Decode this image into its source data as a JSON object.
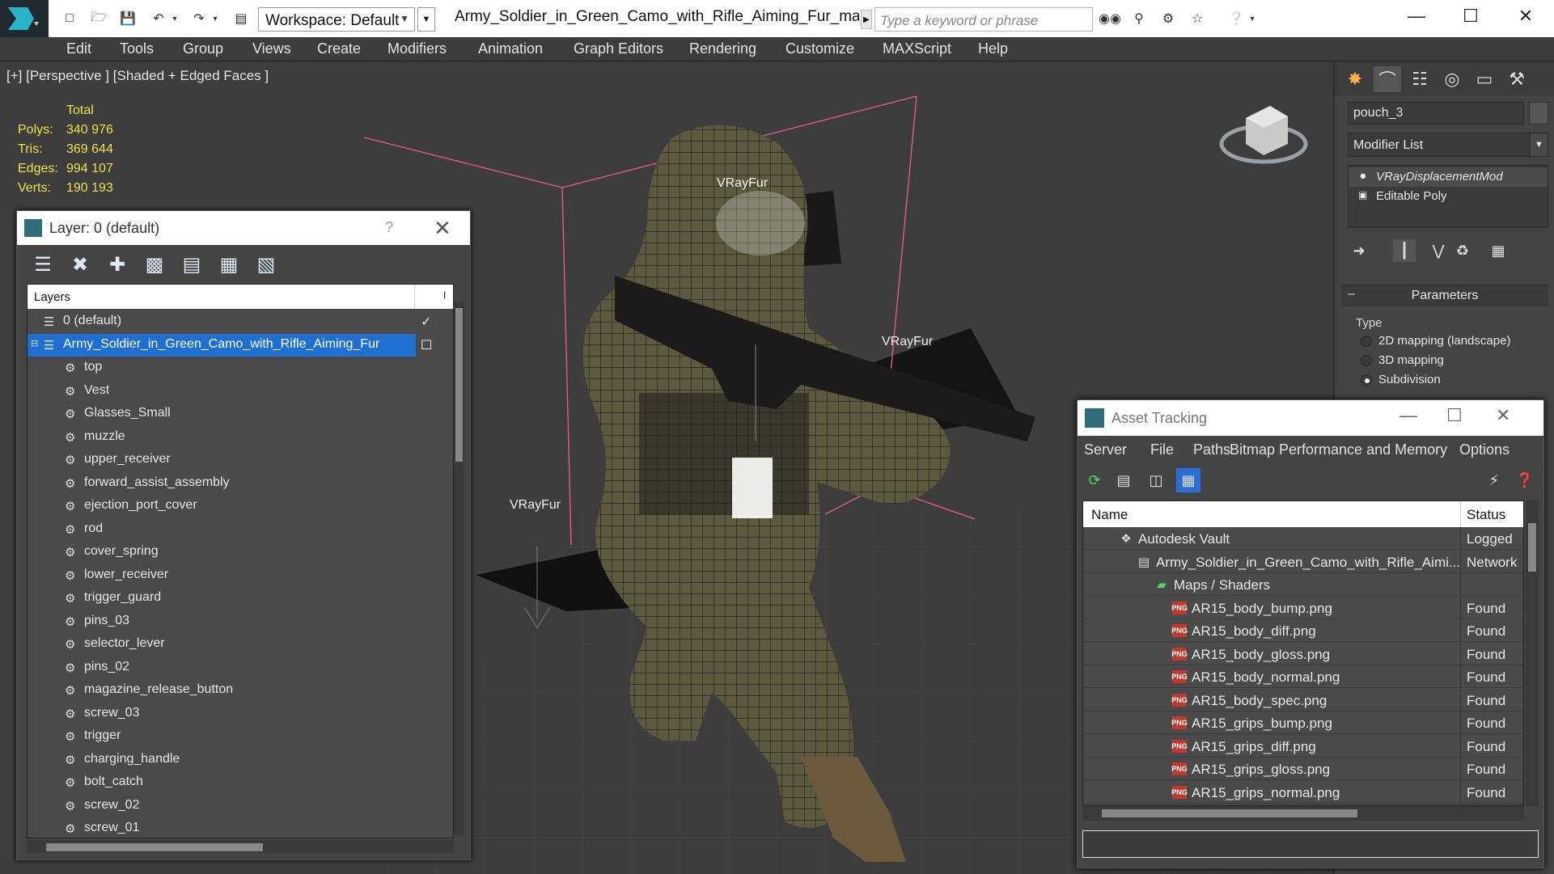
{
  "titlebar": {
    "workspace": "Workspace: Default",
    "document_title": "Army_Soldier_in_Green_Camo_with_Rifle_Aiming_Fur_max_vr...",
    "search_placeholder": "Type a keyword or phrase",
    "minimize": "—",
    "maximize": "☐",
    "close": "✕"
  },
  "menu": [
    "Edit",
    "Tools",
    "Group",
    "Views",
    "Create",
    "Modifiers",
    "Animation",
    "Graph Editors",
    "Rendering",
    "Customize",
    "MAXScript",
    "Help"
  ],
  "viewport": {
    "label": "[+] [Perspective ] [Shaded + Edged Faces ]",
    "stats": {
      "header": "Total",
      "rows": [
        {
          "key": "Polys:",
          "value": "340 976"
        },
        {
          "key": "Tris:",
          "value": "369 644"
        },
        {
          "key": "Edges:",
          "value": "994 107"
        },
        {
          "key": "Verts:",
          "value": "190 193"
        }
      ]
    },
    "fur_labels": [
      "VRayFur",
      "VRayFur",
      "VRayFur"
    ]
  },
  "layer_dialog": {
    "title": "Layer: 0 (default)",
    "help": "?",
    "close": "✕",
    "column_header": "Layers",
    "column2_header": "I",
    "rows": [
      {
        "label": "0 (default)",
        "indent": 1,
        "selected": false,
        "check": "✓"
      },
      {
        "label": "Army_Soldier_in_Green_Camo_with_Rifle_Aiming_Fur",
        "indent": 1,
        "selected": true,
        "check": "☐"
      },
      {
        "label": "top",
        "indent": 2
      },
      {
        "label": "Vest",
        "indent": 2
      },
      {
        "label": "Glasses_Small",
        "indent": 2
      },
      {
        "label": "muzzle",
        "indent": 2
      },
      {
        "label": "upper_receiver",
        "indent": 2
      },
      {
        "label": "forward_assist_assembly",
        "indent": 2
      },
      {
        "label": "ejection_port_cover",
        "indent": 2
      },
      {
        "label": "rod",
        "indent": 2
      },
      {
        "label": "cover_spring",
        "indent": 2
      },
      {
        "label": "lower_receiver",
        "indent": 2
      },
      {
        "label": "trigger_guard",
        "indent": 2
      },
      {
        "label": "pins_03",
        "indent": 2
      },
      {
        "label": "selector_lever",
        "indent": 2
      },
      {
        "label": "pins_02",
        "indent": 2
      },
      {
        "label": "magazine_release_button",
        "indent": 2
      },
      {
        "label": "screw_03",
        "indent": 2
      },
      {
        "label": "trigger",
        "indent": 2
      },
      {
        "label": "charging_handle",
        "indent": 2
      },
      {
        "label": "bolt_catch",
        "indent": 2
      },
      {
        "label": "screw_02",
        "indent": 2
      },
      {
        "label": "screw_01",
        "indent": 2
      }
    ]
  },
  "command_panel": {
    "object_name": "pouch_3",
    "modifier_list": "Modifier List",
    "stack": [
      "VRayDisplacementMod",
      "Editable Poly"
    ],
    "rollout_title": "Parameters",
    "type_label": "Type",
    "type_options": [
      {
        "label": "2D mapping (landscape)",
        "selected": false
      },
      {
        "label": "3D mapping",
        "selected": false
      },
      {
        "label": "Subdivision",
        "selected": true
      }
    ]
  },
  "asset_dialog": {
    "title": "Asset Tracking",
    "menu": [
      "Server",
      "File",
      "Paths",
      "Bitmap Performance and Memory",
      "Options"
    ],
    "columns": {
      "name": "Name",
      "status": "Status"
    },
    "rows": [
      {
        "name": "Autodesk Vault",
        "status": "Logged",
        "indent": 1,
        "icon": "vault"
      },
      {
        "name": "Army_Soldier_in_Green_Camo_with_Rifle_Aimi...",
        "status": "Network",
        "indent": 2,
        "icon": "max"
      },
      {
        "name": "Maps / Shaders",
        "status": "",
        "indent": 3,
        "icon": "maps"
      },
      {
        "name": "AR15_body_bump.png",
        "status": "Found",
        "indent": 4,
        "icon": "png"
      },
      {
        "name": "AR15_body_diff.png",
        "status": "Found",
        "indent": 4,
        "icon": "png"
      },
      {
        "name": "AR15_body_gloss.png",
        "status": "Found",
        "indent": 4,
        "icon": "png"
      },
      {
        "name": "AR15_body_normal.png",
        "status": "Found",
        "indent": 4,
        "icon": "png"
      },
      {
        "name": "AR15_body_spec.png",
        "status": "Found",
        "indent": 4,
        "icon": "png"
      },
      {
        "name": "AR15_grips_bump.png",
        "status": "Found",
        "indent": 4,
        "icon": "png"
      },
      {
        "name": "AR15_grips_diff.png",
        "status": "Found",
        "indent": 4,
        "icon": "png"
      },
      {
        "name": "AR15_grips_gloss.png",
        "status": "Found",
        "indent": 4,
        "icon": "png"
      },
      {
        "name": "AR15_grips_normal.png",
        "status": "Found",
        "indent": 4,
        "icon": "png"
      }
    ],
    "png_badge": "PNG"
  },
  "colors": {
    "selection": "#1f6fd1",
    "stats_text": "#f2e04a",
    "bbox_lines": "#e35a8a",
    "viewport_bg": "#3d3d3d"
  }
}
